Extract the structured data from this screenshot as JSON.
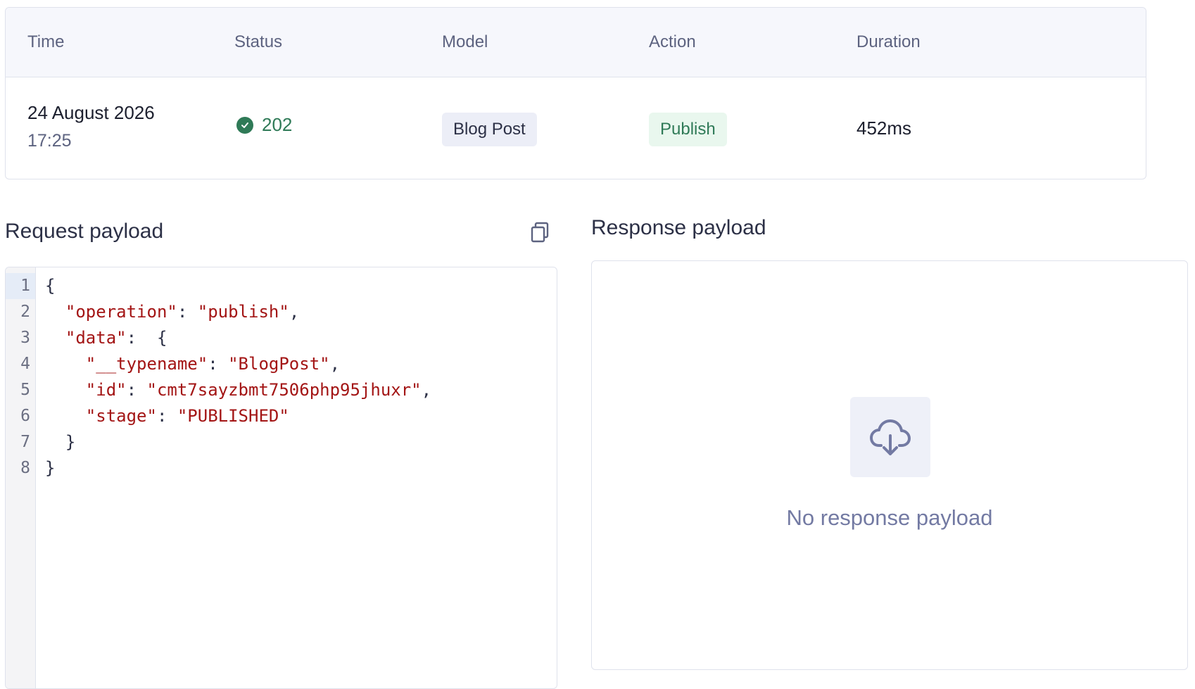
{
  "table": {
    "headers": {
      "time": "Time",
      "status": "Status",
      "model": "Model",
      "action": "Action",
      "duration": "Duration"
    },
    "row": {
      "date": "24 August 2026",
      "time": "17:25",
      "status_code": "202",
      "model": "Blog Post",
      "action": "Publish",
      "duration": "452ms"
    }
  },
  "request": {
    "title": "Request payload",
    "line_numbers": [
      "1",
      "2",
      "3",
      "4",
      "5",
      "6",
      "7",
      "8"
    ],
    "code_lines": [
      {
        "indent": "",
        "key": "",
        "value": "",
        "text": "{"
      },
      {
        "indent": "  ",
        "key": "\"operation\"",
        "value": "\"publish\"",
        "text": ","
      },
      {
        "indent": "  ",
        "key": "\"data\"",
        "value": "",
        "text": " {"
      },
      {
        "indent": "    ",
        "key": "\"__typename\"",
        "value": "\"BlogPost\"",
        "text": ","
      },
      {
        "indent": "    ",
        "key": "\"id\"",
        "value": "\"cmt7sayzbmt7506php95jhuxr\"",
        "text": ","
      },
      {
        "indent": "    ",
        "key": "\"stage\"",
        "value": "\"PUBLISHED\"",
        "text": ""
      },
      {
        "indent": "  ",
        "key": "",
        "value": "",
        "text": "}"
      },
      {
        "indent": "",
        "key": "",
        "value": "",
        "text": "}"
      }
    ]
  },
  "response": {
    "title": "Response payload",
    "empty_message": "No response payload"
  },
  "icons": {
    "status": "check-circle-icon",
    "copy": "copy-icon",
    "empty": "cloud-download-icon"
  },
  "colors": {
    "success": "#2f7a57",
    "string": "#a31515",
    "muted": "#737aa3"
  }
}
